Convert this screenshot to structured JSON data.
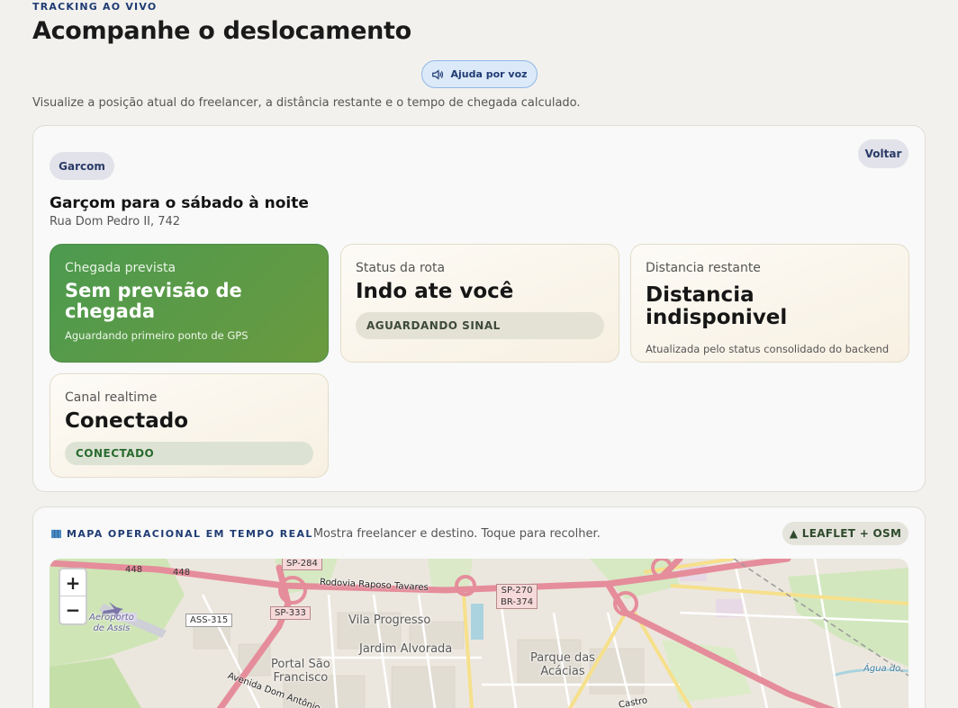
{
  "header": {
    "eyebrow": "TRACKING AO VIVO",
    "title": "Acompanhe o deslocamento",
    "voice_button": "Ajuda por voz",
    "subtitle": "Visualize a posição atual do freelancer, a distância restante e o tempo de chegada calculado."
  },
  "job": {
    "category": "Garcom",
    "back_button": "Voltar",
    "title": "Garçom para o sábado à noite",
    "address": "Rua Dom Pedro II, 742"
  },
  "tiles": {
    "eta": {
      "label": "Chegada prevista",
      "value": "Sem previsão de chegada",
      "note": "Aguardando primeiro ponto de GPS"
    },
    "route": {
      "label": "Status da rota",
      "value": "Indo ate você",
      "badge": "AGUARDANDO SINAL"
    },
    "distance": {
      "label": "Distancia restante",
      "value": "Distancia indisponivel",
      "note": "Atualizada pelo status consolidado do backend"
    },
    "realtime": {
      "label": "Canal realtime",
      "value": "Conectado",
      "badge": "CONECTADO"
    }
  },
  "map_section": {
    "icon": "map-icon",
    "title": "MAPA OPERACIONAL EM TEMPO REAL",
    "description": "Mostra freelancer e destino. Toque para recolher.",
    "engine_badge": "▲ LEAFLET + OSM",
    "zoom_in": "+",
    "zoom_out": "−",
    "labels": {
      "airport": "Aeroporto\nde Assis",
      "vila_progresso": "Vila Progresso",
      "jardim_alvorada": "Jardim Alvorada",
      "portal": "Portal São\nFrancisco",
      "parque": "Parque das\nAcácias",
      "rodovia": "Rodovia Raposo Tavares",
      "avenida": "Avenida Dom Antônio",
      "agua": "Água do",
      "castro": "Castro"
    },
    "shields": {
      "s448a": "448",
      "s448b": "448",
      "sp284": "SP-284",
      "sp333": "SP-333",
      "ass315": "ASS-315",
      "sp270": "SP-270\nBR-374"
    }
  },
  "colors": {
    "accent": "#1f3b73",
    "eta_green": "#4c9a4f",
    "voice_bg": "#dce9f8",
    "road_major": "#e58d9b"
  }
}
